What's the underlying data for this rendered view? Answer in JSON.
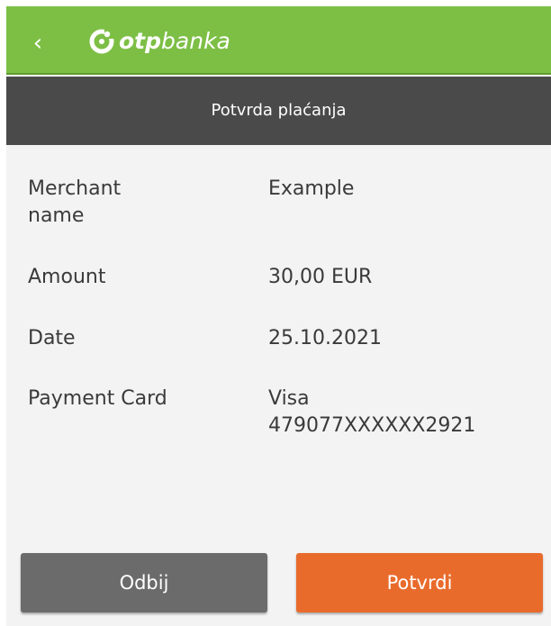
{
  "header": {
    "back_icon": "chevron-left-icon",
    "brand": {
      "bold": "otp",
      "regular": "banka",
      "logo_icon": "otp-logo-icon"
    },
    "color": "#7dbf45"
  },
  "subheader": {
    "title": "Potvrda plaćanja",
    "color": "#4a4a4a"
  },
  "details": [
    {
      "label": "Merchant\nname",
      "value": "Example"
    },
    {
      "label": "Amount",
      "value": "30,00 EUR"
    },
    {
      "label": "Date",
      "value": "25.10.2021"
    },
    {
      "label": "Payment Card",
      "value": "Visa\n479077XXXXXX2921"
    }
  ],
  "actions": {
    "reject_label": "Odbij",
    "confirm_label": "Potvrdi",
    "reject_color": "#6b6b6b",
    "confirm_color": "#e96b2c"
  }
}
